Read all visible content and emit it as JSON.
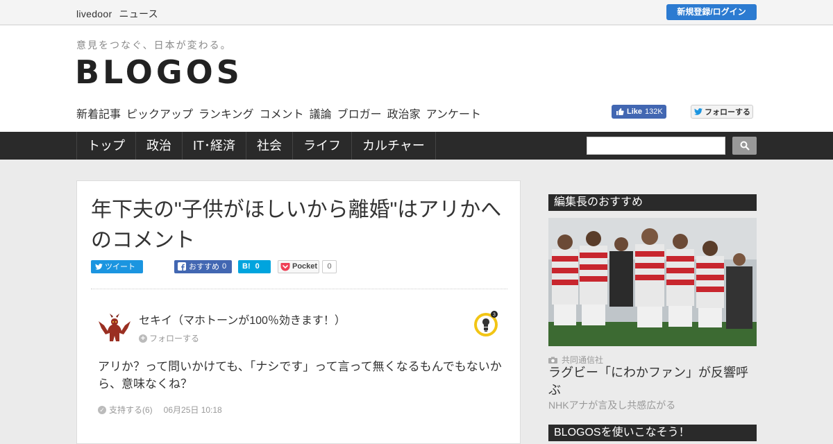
{
  "topbar": {
    "brand_1": "livedoor",
    "brand_2": "ニュース",
    "login": "新規登録/ログイン"
  },
  "header": {
    "tagline": "意見をつなぐ、日本が変わる。",
    "logo": "BLOGOS",
    "subnav": [
      "新着記事",
      "ピックアップ",
      "ランキング",
      "コメント",
      "議論",
      "ブロガー",
      "政治家",
      "アンケート"
    ],
    "fb_like": {
      "label": "Like",
      "count": "132K"
    },
    "tw_follow": "フォローする"
  },
  "mainnav": {
    "items": [
      "トップ",
      "政治",
      "IT･経済",
      "社会",
      "ライフ",
      "カルチャー"
    ],
    "search_placeholder": ""
  },
  "article": {
    "title": "年下夫の\"子供がほしいから離婚\"はアリかへのコメント",
    "share": {
      "tweet": "ツイート",
      "fb_label": "おすすめ",
      "fb_count": "0",
      "hb_label": "B!",
      "hb_count": "0",
      "pocket_label": "Pocket",
      "pocket_count": "0"
    },
    "comment": {
      "user": "セキイ（マホトーンが100％効きます！）",
      "follow": "フォローする",
      "badge_count": "3",
      "text": "アリか？って問いかけても、「ナシです」って言って無くなるもんでもないから、意味なくね？",
      "support": "支持する(6)",
      "date": "06月25日 10:18"
    }
  },
  "sidebar": {
    "section1": "編集長のおすすめ",
    "source": "共同通信社",
    "headline": "ラグビー「にわかファン」が反響呼ぶ",
    "subline": "NHKアナが言及し共感広がる",
    "section2": "BLOGOSを使いこなそう！"
  },
  "colors": {
    "accent": "#2c7bd1",
    "nav_bg": "#2a2a2a",
    "fb": "#4267b2",
    "twitter": "#1b95e0",
    "hatena": "#00a4de"
  }
}
